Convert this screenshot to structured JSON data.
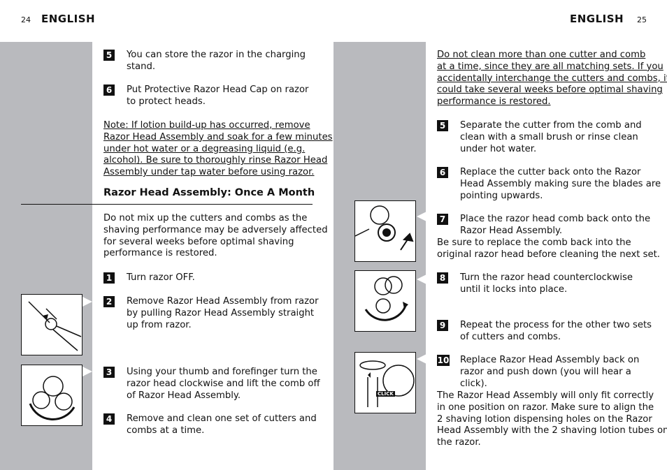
{
  "left": {
    "page_number": "24",
    "header": "ENGLISH",
    "steps_top": [
      {
        "num": "5",
        "lines": [
          "You can store the razor in the charging",
          "stand."
        ]
      },
      {
        "num": "6",
        "lines": [
          "Put Protective Razor Head Cap on razor",
          "to protect heads."
        ]
      }
    ],
    "note": [
      "Note: If lotion build-up has occurred, remove",
      "Razor Head Assembly and soak for a few minutes",
      "under hot water or a degreasing liquid (e.g.",
      "alcohol). Be sure to thoroughly rinse Razor Head",
      "Assembly under tap water before using razor."
    ],
    "subheading": "Razor Head Assembly:  Once A Month",
    "intro": [
      "Do not mix up the cutters and combs as the",
      "shaving performance may be adversely affected",
      "for several weeks before optimal shaving",
      "performance is restored."
    ],
    "steps": [
      {
        "num": "1",
        "lines": [
          "Turn razor OFF."
        ]
      },
      {
        "num": "2",
        "lines": [
          "Remove Razor Head Assembly from razor",
          "by pulling Razor Head Assembly straight",
          "up from razor."
        ]
      },
      {
        "num": "3",
        "lines": [
          "Using your thumb and forefinger turn the",
          "razor head clockwise and lift the comb off",
          "of Razor Head Assembly."
        ]
      },
      {
        "num": "4",
        "lines": [
          "Remove and clean one set of cutters and",
          "combs at a time."
        ]
      }
    ]
  },
  "right": {
    "page_number": "25",
    "header": "ENGLISH",
    "warning": [
      "Do not clean more than one cutter and comb",
      "at a time, since they are all matching sets.  If you",
      "accidentally interchange the cutters and combs, it",
      "could take several weeks before optimal shaving",
      "performance is restored."
    ],
    "steps": [
      {
        "num": "5",
        "lines": [
          "Separate the cutter from the comb and",
          "clean with a small brush or rinse clean",
          "under hot water."
        ]
      },
      {
        "num": "6",
        "lines": [
          "Replace the cutter back onto the Razor",
          "Head Assembly making sure the blades are",
          "pointing upwards."
        ]
      },
      {
        "num": "7",
        "lines": [
          "Place the razor head comb back onto the",
          "Razor Head Assembly."
        ]
      },
      {
        "num": "8",
        "lines": [
          "Turn the razor head counterclockwise",
          "until it locks into place."
        ]
      },
      {
        "num": "9",
        "lines": [
          "Repeat the process for the other two sets",
          "of cutters and combs."
        ]
      },
      {
        "num": "10",
        "lines": [
          "Replace Razor Head Assembly back on",
          "razor and push down (you will hear a",
          "click)."
        ]
      }
    ],
    "step7_note": [
      "Be sure to replace the comb back into the",
      "original razor head before cleaning the next set."
    ],
    "step10_note": [
      "The Razor Head Assembly will only fit correctly",
      "in one position on razor.  Make sure to align the",
      "2 shaving lotion dispensing holes on the Razor",
      "Head Assembly with the 2 shaving lotion tubes on",
      "the razor."
    ],
    "click_label": "CLICK"
  },
  "colors": {
    "sidebar_gray": "#b9babe",
    "badge": "#111111"
  }
}
